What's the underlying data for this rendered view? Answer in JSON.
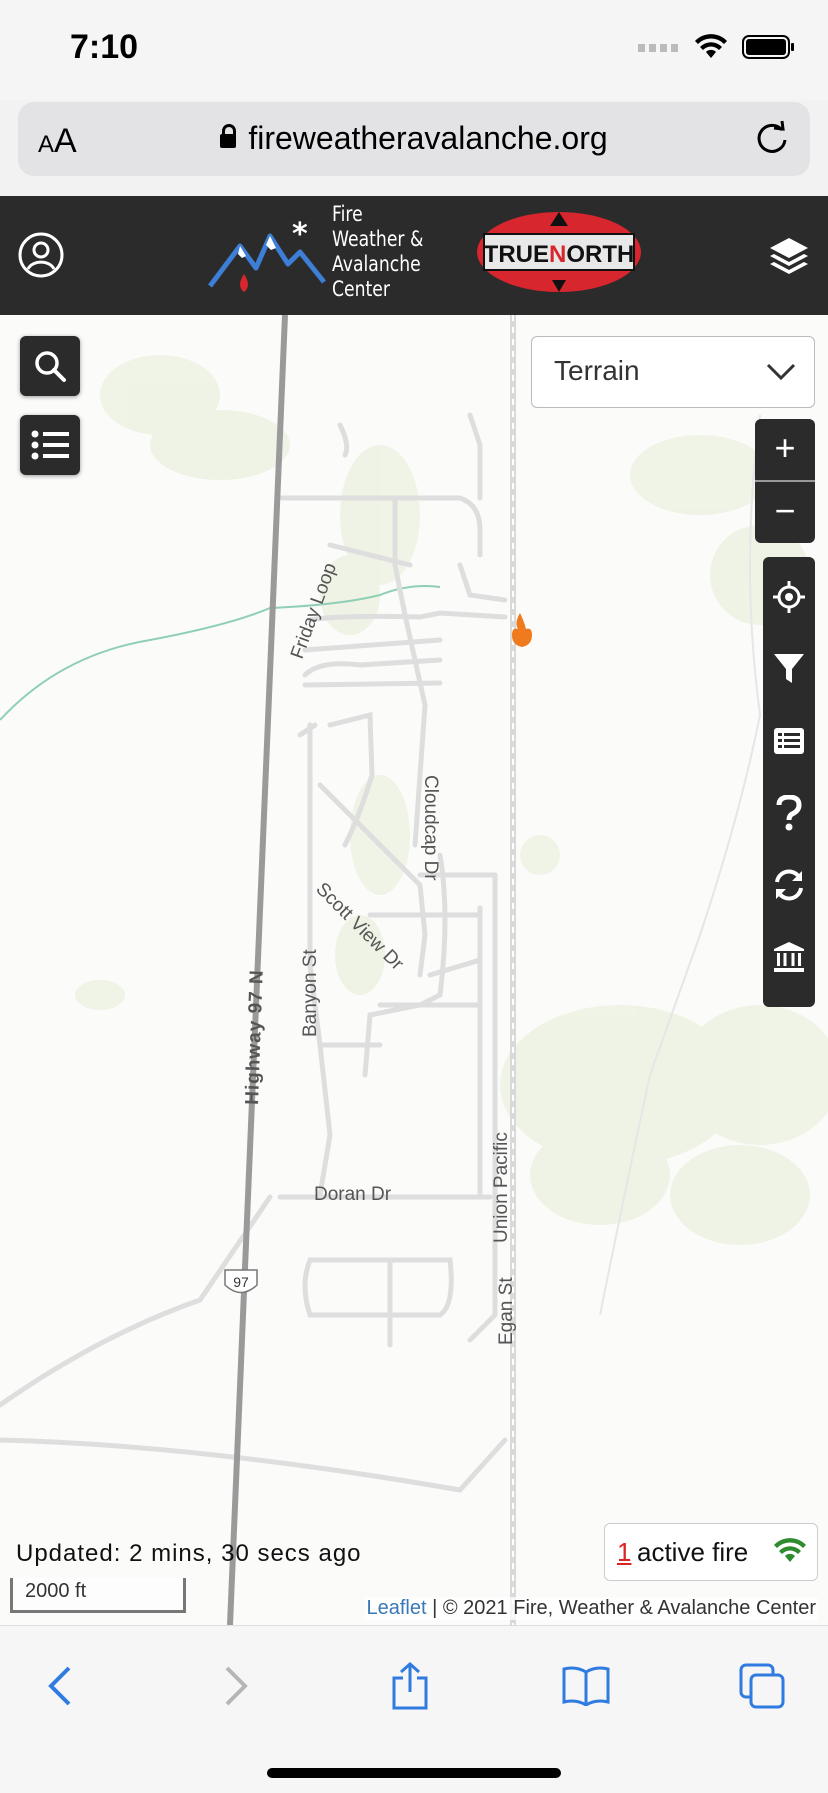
{
  "status_bar": {
    "time": "7:10"
  },
  "browser": {
    "text_size_label_small": "A",
    "text_size_label_large": "A",
    "url": "fireweatheravalanche.org"
  },
  "header": {
    "logo_lines": [
      "Fire",
      "Weather &",
      "Avalanche",
      "Center"
    ],
    "partner_logo": "TRUENORTH",
    "partner_logo_parts": {
      "left": "TRUE",
      "mid": "N",
      "right": "ORTH"
    }
  },
  "map": {
    "basemap_select": {
      "selected": "Terrain"
    },
    "zoom": {
      "in": "+",
      "out": "−"
    },
    "labels": {
      "friday_loop": "Friday Loop",
      "cloudcap": "Cloudcap Dr",
      "scott_view": "Scott View Dr",
      "banyon": "Banyon St",
      "highway": "Highway 97 N",
      "route_shield": "97",
      "doran": "Doran Dr",
      "union_pacific": "Union Pacific",
      "egan": "Egan St"
    },
    "toolbar_icons": [
      "locate-icon",
      "filter-icon",
      "list-icon",
      "help-icon",
      "refresh-icon",
      "museum-icon"
    ],
    "updated": "Updated: 2 mins, 30 secs ago",
    "scale": "2000 ft",
    "active_fire": {
      "count": "1",
      "label": "active fire"
    },
    "attribution": {
      "link": "Leaflet",
      "separator": "|",
      "text": "© 2021 Fire, Weather & Avalanche Center"
    }
  },
  "colors": {
    "header_bg": "#2b2b2b",
    "fire_orange": "#f07a1e",
    "wifi_green": "#2e8b2e",
    "link_blue": "#3a78b8",
    "ios_blue": "#2f7be0"
  }
}
